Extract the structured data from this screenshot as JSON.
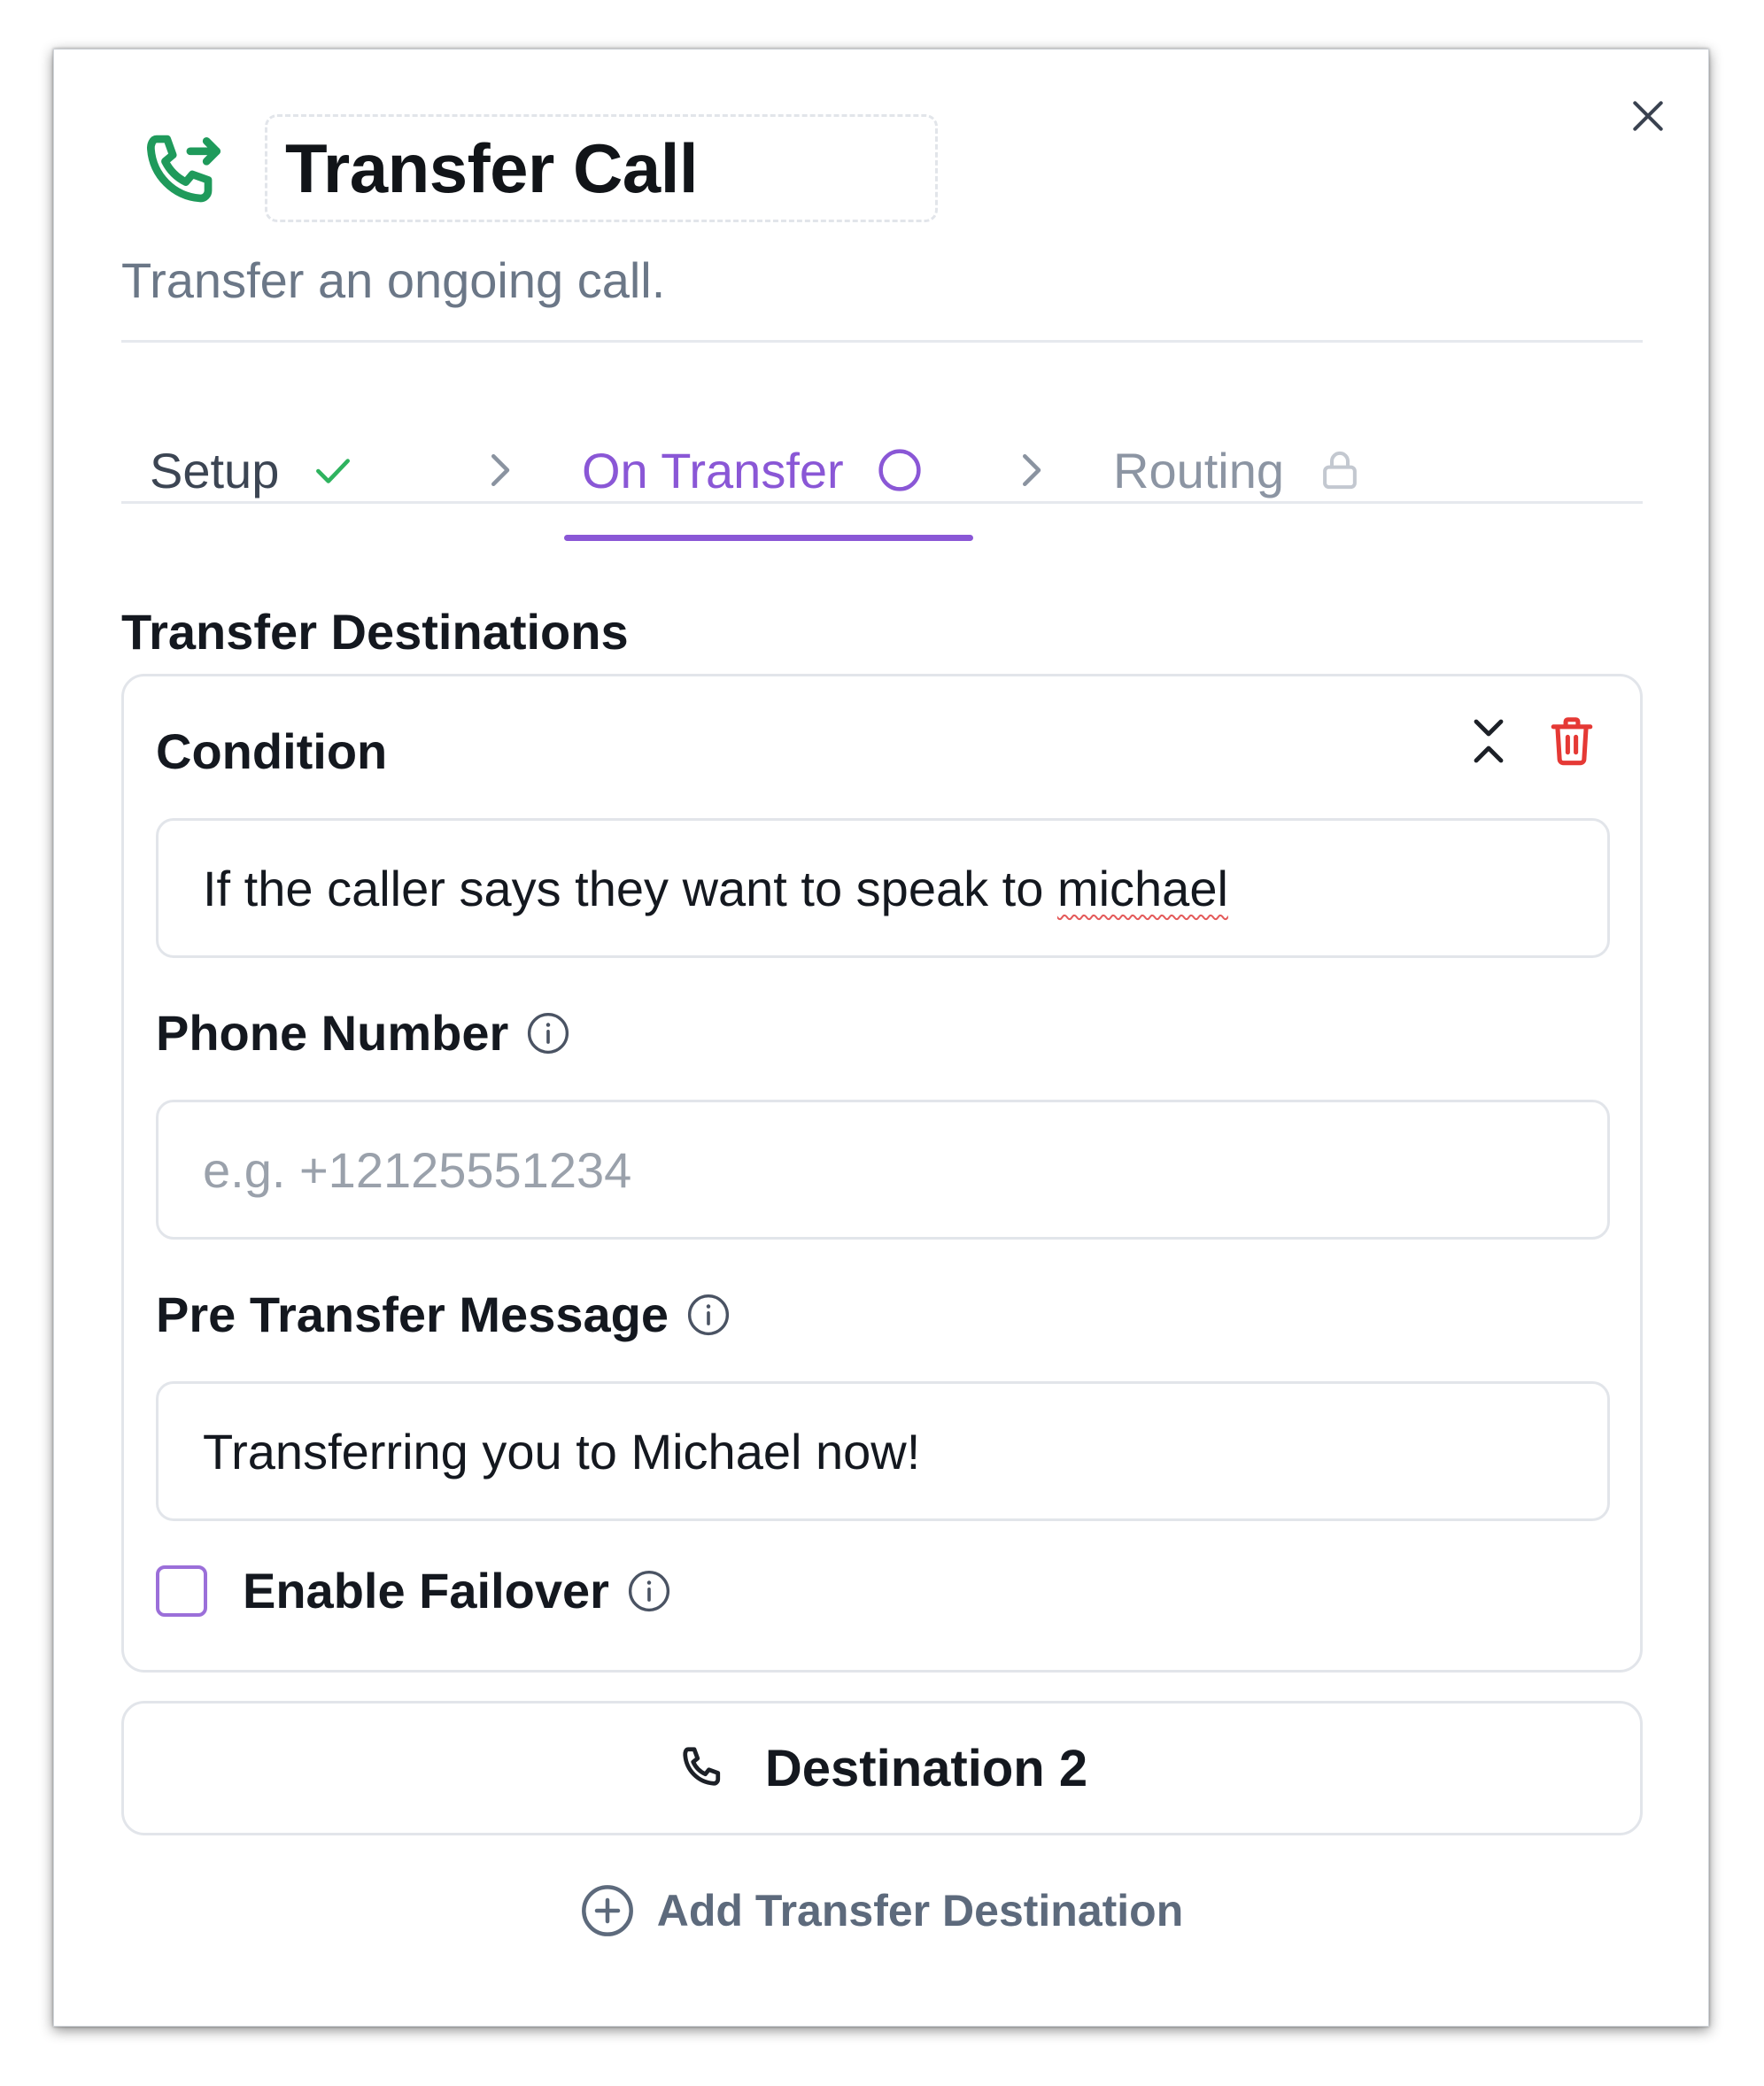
{
  "header": {
    "title": "Transfer Call",
    "subtitle": "Transfer an ongoing call.",
    "icon": "phone-forward-icon",
    "icon_color": "#1f9a5b"
  },
  "tabs": [
    {
      "label": "Setup",
      "status": "complete",
      "status_icon": "check-icon",
      "status_color": "#2fb35f"
    },
    {
      "label": "On Transfer",
      "status": "active",
      "status_icon": "circle-icon",
      "status_color": "#8a57d6"
    },
    {
      "label": "Routing",
      "status": "locked",
      "status_icon": "lock-icon",
      "status_color": "#c3c8d0"
    }
  ],
  "section": {
    "title": "Transfer Destinations"
  },
  "destination1": {
    "condition_label": "Condition",
    "condition_value_prefix": "If the caller says they want to speak to ",
    "condition_value_misspelled": "michael",
    "phone_label": "Phone Number",
    "phone_placeholder": "e.g. +12125551234",
    "phone_value": "",
    "message_label": "Pre Transfer Message",
    "message_value": "Transferring you to Michael now!",
    "failover_label": "Enable Failover",
    "failover_checked": false,
    "delete_color": "#e53935"
  },
  "destination2": {
    "label": "Destination 2",
    "icon": "phone-icon"
  },
  "add_destination": {
    "label": "Add Transfer Destination",
    "icon": "plus-circle-icon"
  },
  "colors": {
    "accent": "#8a57d6",
    "text": "#14181f",
    "muted": "#6b7787",
    "border": "#e2e5ea"
  }
}
